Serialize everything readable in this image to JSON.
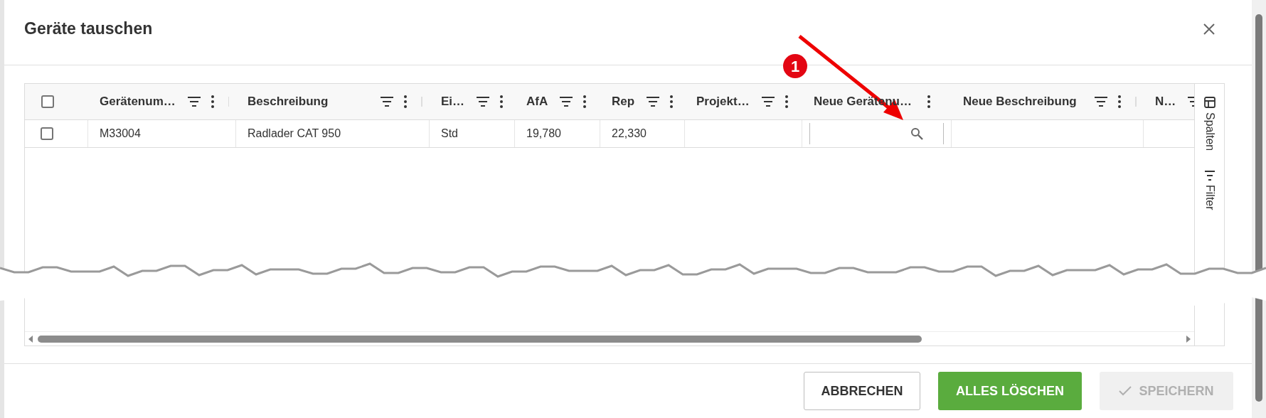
{
  "dialog": {
    "title": "Geräte tauschen"
  },
  "grid": {
    "columns": [
      {
        "label": "Gerätenum…",
        "filter": true,
        "kind": "text"
      },
      {
        "label": "Beschreibung",
        "filter": true,
        "kind": "text"
      },
      {
        "label": "Ei…",
        "filter": true,
        "kind": "text"
      },
      {
        "label": "AfA",
        "filter": true,
        "kind": "text"
      },
      {
        "label": "Rep",
        "filter": true,
        "kind": "text"
      },
      {
        "label": "Projekt…",
        "filter": true,
        "kind": "text"
      },
      {
        "label": "Neue Gerätenu…",
        "filter": false,
        "kind": "search"
      },
      {
        "label": "Neue Beschreibung",
        "filter": true,
        "kind": "text"
      },
      {
        "label": "N…",
        "filter": true,
        "kind": "text"
      }
    ],
    "rows": [
      {
        "checked": false,
        "cells": [
          "M33004",
          "Radlader CAT 950",
          "Std",
          "19,780",
          "22,330",
          "",
          "",
          "",
          ""
        ]
      }
    ],
    "header_checked": false,
    "side_tabs": [
      {
        "label": "Spalten",
        "kind": "columns"
      },
      {
        "label": "Filter",
        "kind": "filter"
      }
    ]
  },
  "annotation": {
    "label": "1"
  },
  "buttons": [
    {
      "label": "ABBRECHEN",
      "kind": "outline",
      "disabled": false
    },
    {
      "label": "ALLES LÖSCHEN",
      "kind": "primary",
      "disabled": false
    },
    {
      "label": "SPEICHERN",
      "kind": "save",
      "disabled": true
    }
  ]
}
